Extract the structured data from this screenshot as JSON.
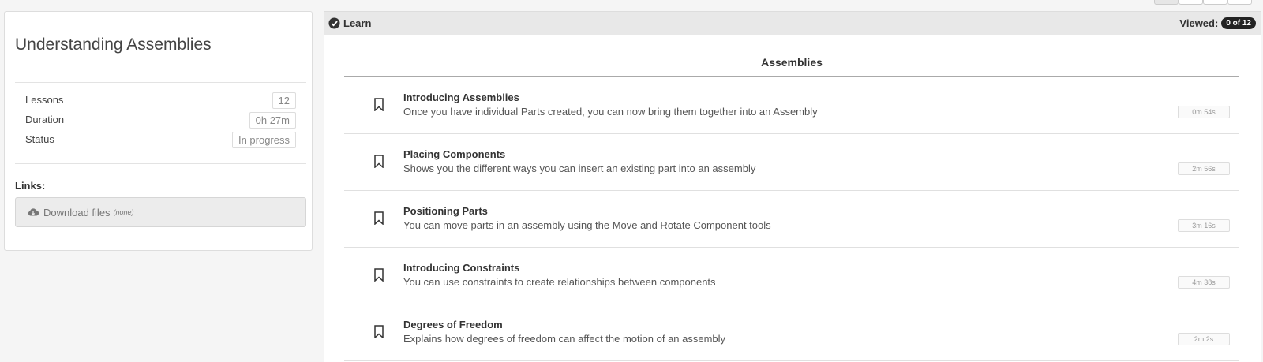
{
  "course": {
    "title": "Understanding Assemblies",
    "meta": [
      {
        "label": "Lessons",
        "value": "12"
      },
      {
        "label": "Duration",
        "value": "0h 27m"
      },
      {
        "label": "Status",
        "value": "In progress"
      }
    ],
    "links_label": "Links:",
    "download": {
      "label": "Download files",
      "note": "(none)",
      "icon": "cloud-download-icon"
    }
  },
  "panel": {
    "header_title": "Learn",
    "header_icon": "check-circle-icon",
    "viewed_label": "Viewed:",
    "viewed_count": "0 of 12",
    "section_title": "Assemblies"
  },
  "lessons": [
    {
      "title": "Introducing Assemblies",
      "desc": "Once you have individual Parts created, you can now bring them together into an Assembly",
      "duration": "0m 54s"
    },
    {
      "title": "Placing Components",
      "desc": "Shows you the different ways you can insert an existing part into an assembly",
      "duration": "2m 56s"
    },
    {
      "title": "Positioning Parts",
      "desc": "You can move parts in an assembly using the Move and Rotate Component tools",
      "duration": "3m 16s"
    },
    {
      "title": "Introducing Constraints",
      "desc": "You can use constraints to create relationships between components",
      "duration": "4m 38s"
    },
    {
      "title": "Degrees of Freedom",
      "desc": "Explains how degrees of freedom can affect the motion of an assembly",
      "duration": "2m 2s"
    }
  ],
  "colors": {
    "badge_bg": "#222222",
    "header_bg": "#e8e8e8"
  }
}
